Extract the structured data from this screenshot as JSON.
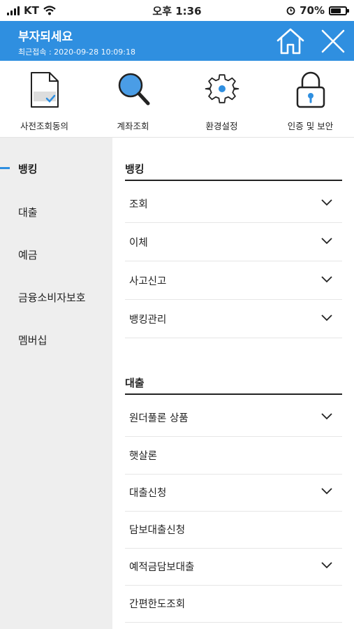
{
  "status_bar": {
    "carrier": "KT",
    "time": "오후 1:36",
    "battery_percent": "70%",
    "battery_level": 0.7
  },
  "header": {
    "title": "부자되세요",
    "subtitle": "최근접속 : 2020-09-28 10:09:18",
    "home_icon": "home-icon",
    "close_icon": "close-icon",
    "background_color": "#2f8fe0"
  },
  "quick_menu": [
    {
      "label": "사전조회동의",
      "icon": "document-check-icon"
    },
    {
      "label": "계좌조회",
      "icon": "magnifier-icon"
    },
    {
      "label": "환경설정",
      "icon": "gear-icon"
    },
    {
      "label": "인증 및 보안",
      "icon": "lock-icon"
    }
  ],
  "left_nav": [
    {
      "label": "뱅킹",
      "active": true
    },
    {
      "label": "대출",
      "active": false
    },
    {
      "label": "예금",
      "active": false
    },
    {
      "label": "금융소비자보호",
      "active": false
    },
    {
      "label": "멤버십",
      "active": false
    }
  ],
  "sections": [
    {
      "title": "뱅킹",
      "items": [
        {
          "label": "조회",
          "expandable": true
        },
        {
          "label": "이체",
          "expandable": true
        },
        {
          "label": "사고신고",
          "expandable": true
        },
        {
          "label": "뱅킹관리",
          "expandable": true
        }
      ]
    },
    {
      "title": "대출",
      "items": [
        {
          "label": "원더풀론 상품",
          "expandable": true
        },
        {
          "label": "햇살론",
          "expandable": false
        },
        {
          "label": "대출신청",
          "expandable": true
        },
        {
          "label": "담보대출신청",
          "expandable": false
        },
        {
          "label": "예적금담보대출",
          "expandable": true
        },
        {
          "label": "간편한도조회",
          "expandable": false
        }
      ]
    }
  ],
  "colors": {
    "accent": "#2f8fe0",
    "nav_background": "#eeeeee"
  }
}
